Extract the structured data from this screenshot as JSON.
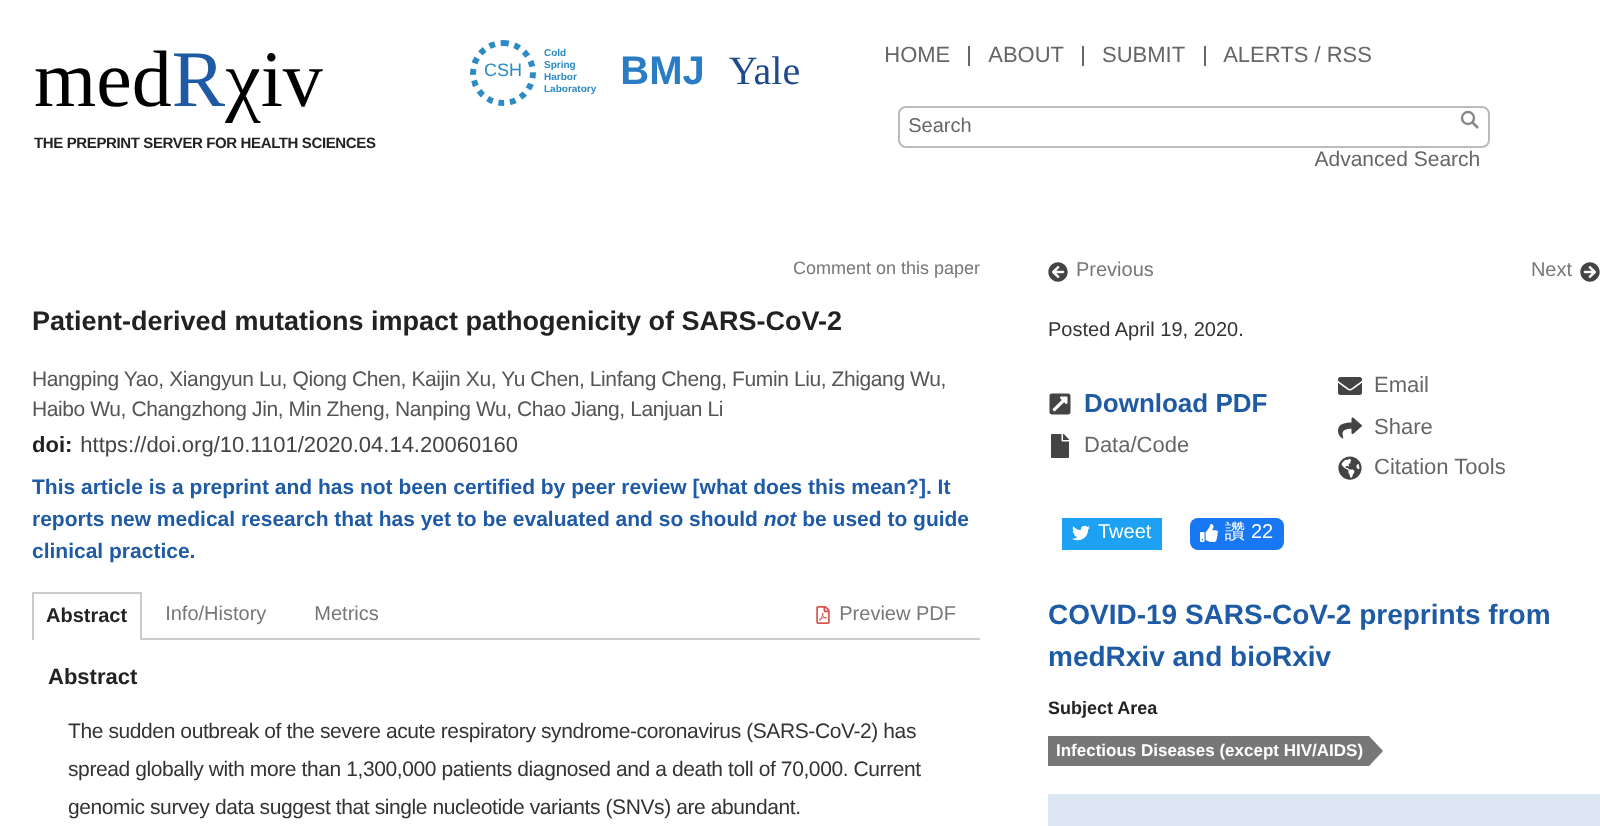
{
  "header": {
    "logo": {
      "prefix": "med",
      "accent": "R",
      "suffix": "χiv"
    },
    "tagline": "THE PREPRINT SERVER FOR HEALTH SCIENCES",
    "partners": {
      "csh_mark": "CSH",
      "csh_name": [
        "Cold",
        "Spring",
        "Harbor",
        "Laboratory"
      ],
      "bmj": "BMJ",
      "yale": "Yale"
    },
    "nav": [
      "HOME",
      "ABOUT",
      "SUBMIT",
      "ALERTS / RSS"
    ],
    "search": {
      "placeholder": "Search"
    },
    "advanced_search": "Advanced Search"
  },
  "article": {
    "comment_link": "Comment on this paper",
    "title": "Patient-derived mutations impact pathogenicity of SARS-CoV-2",
    "authors": "Hangping Yao, Xiangyun Lu, Qiong Chen, Kaijin Xu, Yu Chen, Linfang Cheng, Fumin Liu, Zhigang Wu, Haibo Wu, Changzhong Jin, Min Zheng, Nanping Wu, Chao Jiang, Lanjuan Li",
    "doi_label": "doi:",
    "doi": "https://doi.org/10.1101/2020.04.14.20060160",
    "notice": {
      "before": "This article is a preprint and has not been certified by peer review ",
      "link": "[what does this mean?]",
      "after": ". It reports new medical research that has yet to be evaluated and so should *not* be used to guide clinical practice."
    },
    "tabs": [
      {
        "label": "Abstract",
        "selected": true
      },
      {
        "label": "Info/History",
        "selected": false
      },
      {
        "label": "Metrics",
        "selected": false
      }
    ],
    "preview_pdf": "Preview PDF",
    "abstract_heading": "Abstract",
    "abstract_text": "The sudden outbreak of the severe acute respiratory syndrome-coronavirus (SARS-CoV-2) has spread globally with more than 1,300,000 patients diagnosed and a death toll of 70,000. Current genomic survey data suggest that single nucleotide variants (SNVs) are abundant."
  },
  "sidebar": {
    "previous": "Previous",
    "next": "Next",
    "posted": "Posted April 19, 2020.",
    "actions_left": [
      {
        "kind": "download",
        "label": "Download PDF"
      },
      {
        "kind": "data",
        "label": "Data/Code"
      }
    ],
    "actions_right": [
      {
        "kind": "email",
        "label": "Email"
      },
      {
        "kind": "share",
        "label": "Share"
      },
      {
        "kind": "cite",
        "label": "Citation Tools"
      }
    ],
    "tweet": "Tweet",
    "like": "讚 22",
    "collection_heading": "COVID-19 SARS-CoV-2 preprints from medRxiv and bioRxiv",
    "subject_area_label": "Subject Area",
    "subject_tag": "Infectious Diseases (except HIV/AIDS)"
  }
}
